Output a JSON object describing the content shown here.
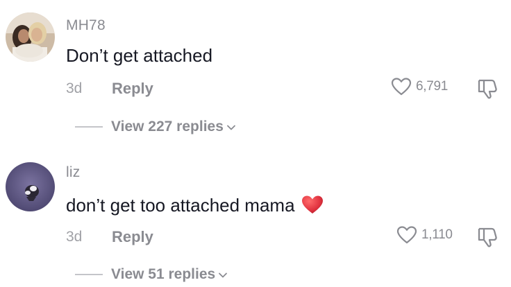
{
  "comments": [
    {
      "username": "MH78",
      "text": "Don’t get attached",
      "timestamp": "3d",
      "reply_label": "Reply",
      "like_count": "6,791",
      "view_replies_label": "View 227 replies",
      "avatar_icon": "couple-photo-avatar"
    },
    {
      "username": "liz",
      "text": "don’t get too attached mama",
      "emoji_icon": "red-heart-icon",
      "timestamp": "3d",
      "reply_label": "Reply",
      "like_count": "1,110",
      "view_replies_label": "View 51 replies",
      "avatar_icon": "bird-photo-avatar"
    }
  ],
  "colors": {
    "username": "#8a8b91",
    "text": "#161823",
    "meta": "#a0a1a6",
    "heart_emoji": "#e0323f",
    "background": "#ffffff"
  }
}
